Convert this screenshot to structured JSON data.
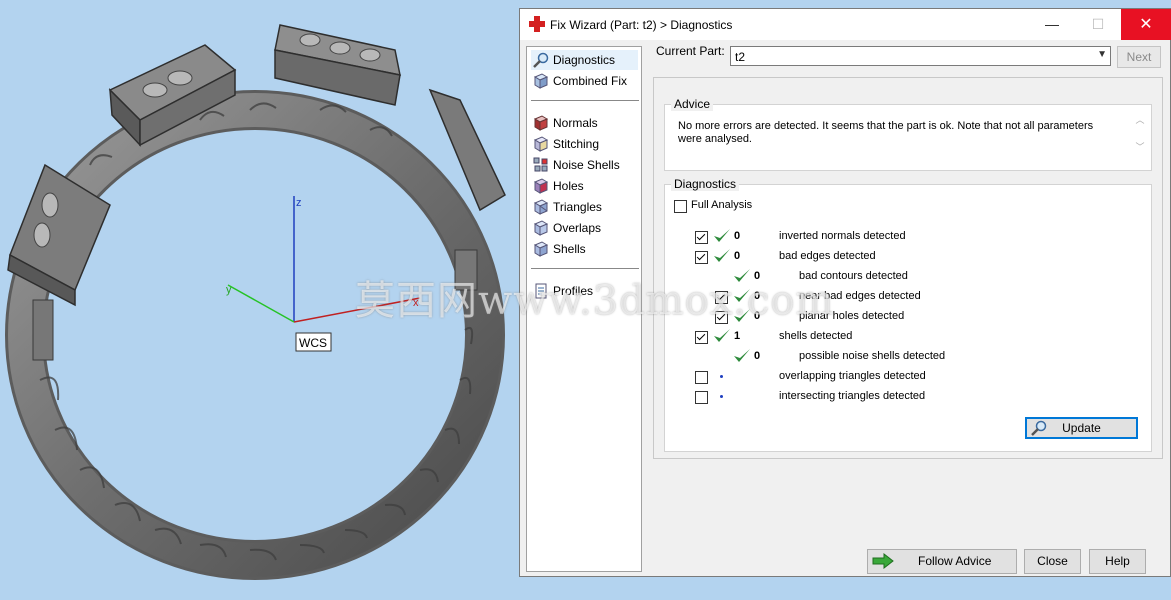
{
  "viewport": {
    "axis_labels": {
      "z": "z",
      "y": "y",
      "x": "x"
    },
    "wcs_label": "WCS",
    "background": "#b3d3ef",
    "watermark": "莫西网www.3dmox.com"
  },
  "window": {
    "title": "Fix Wizard (Part: t2) > Diagnostics",
    "title_controls": {
      "minimize": "—",
      "maximize": "☐",
      "close": "✕"
    }
  },
  "nav": {
    "items_top": [
      {
        "label": "Diagnostics",
        "icon": "magnifier-icon"
      },
      {
        "label": "Combined Fix",
        "icon": "cube-icon"
      }
    ],
    "items_tools": [
      {
        "label": "Normals",
        "icon": "normals-cube-icon"
      },
      {
        "label": "Stitching",
        "icon": "stitching-cube-icon"
      },
      {
        "label": "Noise Shells",
        "icon": "noise-shells-icon"
      },
      {
        "label": "Holes",
        "icon": "holes-cube-icon"
      },
      {
        "label": "Triangles",
        "icon": "triangles-cube-icon"
      },
      {
        "label": "Overlaps",
        "icon": "overlaps-cube-icon"
      },
      {
        "label": "Shells",
        "icon": "shells-cube-icon"
      }
    ],
    "items_bottom": [
      {
        "label": "Profiles",
        "icon": "profiles-icon"
      }
    ]
  },
  "current_part": {
    "label": "Current Part:",
    "value": "t2",
    "next_label": "Next"
  },
  "advice": {
    "title": "Advice",
    "text": "No more errors are detected. It seems that the part is ok. Note that not all parameters were analysed."
  },
  "diagnostics": {
    "title": "Diagnostics",
    "full_analysis": {
      "label": "Full Analysis",
      "checked": false
    },
    "rows": [
      {
        "checkbox": true,
        "checked": true,
        "tick": true,
        "count": "0",
        "text": "inverted normals detected",
        "indent": 0
      },
      {
        "checkbox": true,
        "checked": true,
        "tick": true,
        "count": "0",
        "text": "bad edges detected",
        "indent": 0
      },
      {
        "checkbox": false,
        "checked": false,
        "tick": true,
        "count": "0",
        "text": "bad contours detected",
        "indent": 1
      },
      {
        "checkbox": true,
        "checked": true,
        "tick": true,
        "count": "0",
        "text": "near bad edges detected",
        "indent": 1
      },
      {
        "checkbox": true,
        "checked": true,
        "tick": true,
        "count": "0",
        "text": "planar holes detected",
        "indent": 1
      },
      {
        "checkbox": true,
        "checked": true,
        "tick": true,
        "count": "1",
        "text": "shells detected",
        "indent": 0
      },
      {
        "checkbox": false,
        "checked": false,
        "tick": true,
        "count": "0",
        "text": "possible noise shells detected",
        "indent": 1
      },
      {
        "checkbox": true,
        "checked": false,
        "tick": false,
        "count": "",
        "text": "overlapping triangles detected",
        "indent": 0
      },
      {
        "checkbox": true,
        "checked": false,
        "tick": false,
        "count": "",
        "text": "intersecting triangles detected",
        "indent": 0
      }
    ],
    "update_label": "Update"
  },
  "buttons": {
    "follow_advice": "Follow Advice",
    "close": "Close",
    "help": "Help"
  },
  "colors": {
    "tick": "#2e8b3c",
    "accent": "#0078d7",
    "close_red": "#e81123"
  }
}
